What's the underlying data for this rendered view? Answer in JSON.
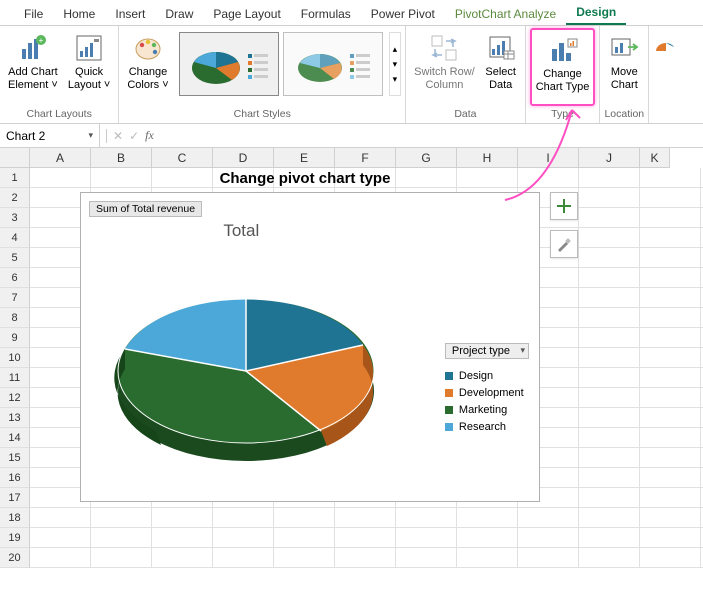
{
  "tabs": [
    "File",
    "Home",
    "Insert",
    "Draw",
    "Page Layout",
    "Formulas",
    "Power Pivot",
    "PivotChart Analyze",
    "Design"
  ],
  "active_tab": "Design",
  "ribbon": {
    "chart_layouts": {
      "label": "Chart Layouts",
      "add_el": "Add Chart\nElement ˅",
      "quick": "Quick\nLayout ˅"
    },
    "change_colors": "Change\nColors ˅",
    "chart_styles": {
      "label": "Chart Styles"
    },
    "data": {
      "label": "Data",
      "switch": "Switch Row/\nColumn",
      "select": "Select\nData"
    },
    "type": {
      "label": "Type",
      "change": "Change\nChart Type"
    },
    "location": {
      "label": "Location",
      "move": "Move\nChart"
    }
  },
  "namebox": "Chart 2",
  "formula": "",
  "columns": [
    "A",
    "B",
    "C",
    "D",
    "E",
    "F",
    "G",
    "H",
    "I",
    "J",
    "K"
  ],
  "rows": [
    1,
    2,
    3,
    4,
    5,
    6,
    7,
    8,
    9,
    10,
    11,
    12,
    13,
    14,
    15,
    16,
    17,
    18,
    19,
    20
  ],
  "chart": {
    "heading": "Change pivot chart type",
    "badge": "Sum of Total revenue",
    "inner_title": "Total",
    "legend_title": "Project type",
    "legend_items": [
      {
        "label": "Design",
        "color": "#1f7393"
      },
      {
        "label": "Development",
        "color": "#e07b2e"
      },
      {
        "label": "Marketing",
        "color": "#2a6b2f"
      },
      {
        "label": "Research",
        "color": "#4ba8d8"
      }
    ]
  },
  "chart_data": {
    "type": "pie",
    "title": "Total",
    "series_name": "Sum of Total revenue",
    "categories": [
      "Design",
      "Development",
      "Marketing",
      "Research"
    ],
    "values": [
      20,
      20,
      35,
      25
    ],
    "colors": [
      "#1f7393",
      "#e07b2e",
      "#2a6b2f",
      "#4ba8d8"
    ],
    "legend_position": "right",
    "style": "3d"
  }
}
